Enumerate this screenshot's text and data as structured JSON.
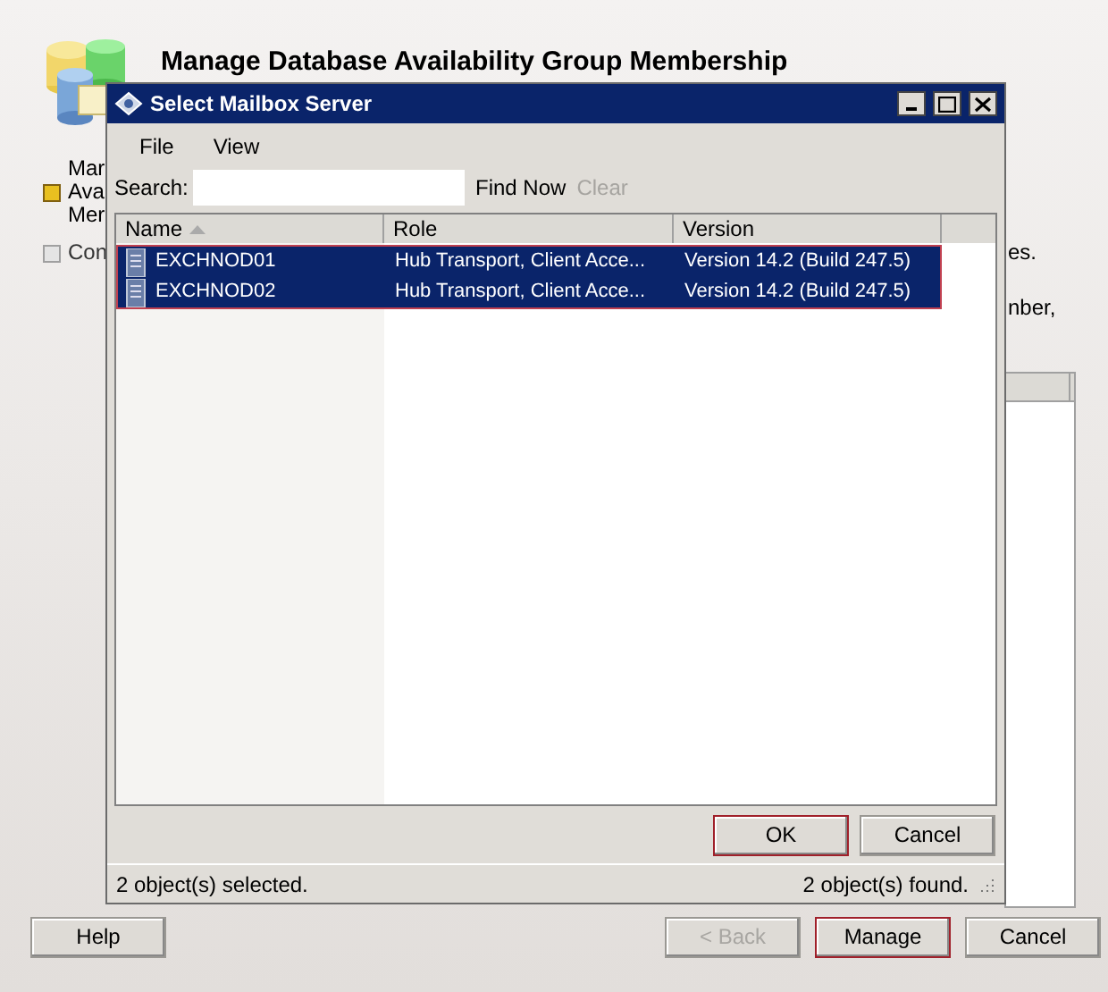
{
  "wizard": {
    "title": "Manage Database Availability Group Membership",
    "left_items": [
      {
        "lines": [
          "Mar",
          "Ava",
          "Mer"
        ],
        "selected": true
      },
      {
        "lines": [
          "Con"
        ],
        "selected": false
      }
    ],
    "right_texts": [
      "es.",
      "nber,"
    ],
    "buttons": [
      {
        "label": "Help",
        "disabled": false,
        "default": false
      },
      {
        "label": "< Back",
        "disabled": true,
        "default": false
      },
      {
        "label": "Manage",
        "disabled": false,
        "default": true
      },
      {
        "label": "Cancel",
        "disabled": false,
        "default": false
      }
    ]
  },
  "dialog": {
    "title": "Select Mailbox Server",
    "menu": [
      "File",
      "View"
    ],
    "search": {
      "label": "Search:"
    },
    "search_buttons": [
      {
        "label": "Find Now",
        "disabled": false
      },
      {
        "label": "Clear",
        "disabled": true
      }
    ],
    "columns": [
      {
        "label": "Name",
        "sorted": true
      },
      {
        "label": "Role",
        "sorted": false
      },
      {
        "label": "Version",
        "sorted": false
      }
    ],
    "rows": [
      {
        "name": "EXCHNOD01",
        "role": "Hub Transport, Client Acce...",
        "version": "Version 14.2 (Build 247.5)",
        "selected": true
      },
      {
        "name": "EXCHNOD02",
        "role": "Hub Transport, Client Acce...",
        "version": "Version 14.2 (Build 247.5)",
        "selected": true
      }
    ],
    "buttons": [
      {
        "label": "OK",
        "default": true
      },
      {
        "label": "Cancel",
        "default": false
      }
    ],
    "status_left": "2 object(s) selected.",
    "status_right": "2 object(s) found."
  }
}
